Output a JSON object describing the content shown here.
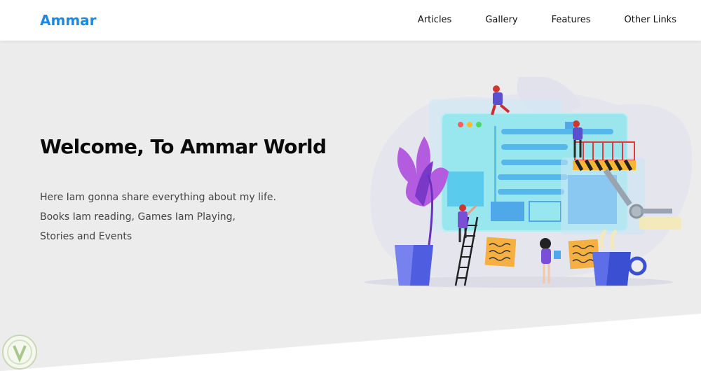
{
  "header": {
    "logo": "Ammar",
    "nav": [
      {
        "label": "Articles"
      },
      {
        "label": "Gallery"
      },
      {
        "label": "Features"
      },
      {
        "label": "Other Links"
      }
    ]
  },
  "hero": {
    "title": "Welcome, To Ammar World",
    "lines": [
      "Here Iam gonna share everything about my life.",
      "Books Iam reading, Games Iam Playing,",
      "Stories and Events"
    ]
  },
  "colors": {
    "brand": "#1e88e5",
    "background": "#ececec",
    "header_bg": "#ffffff"
  },
  "illustration": {
    "name": "web-design-team-illustration"
  }
}
